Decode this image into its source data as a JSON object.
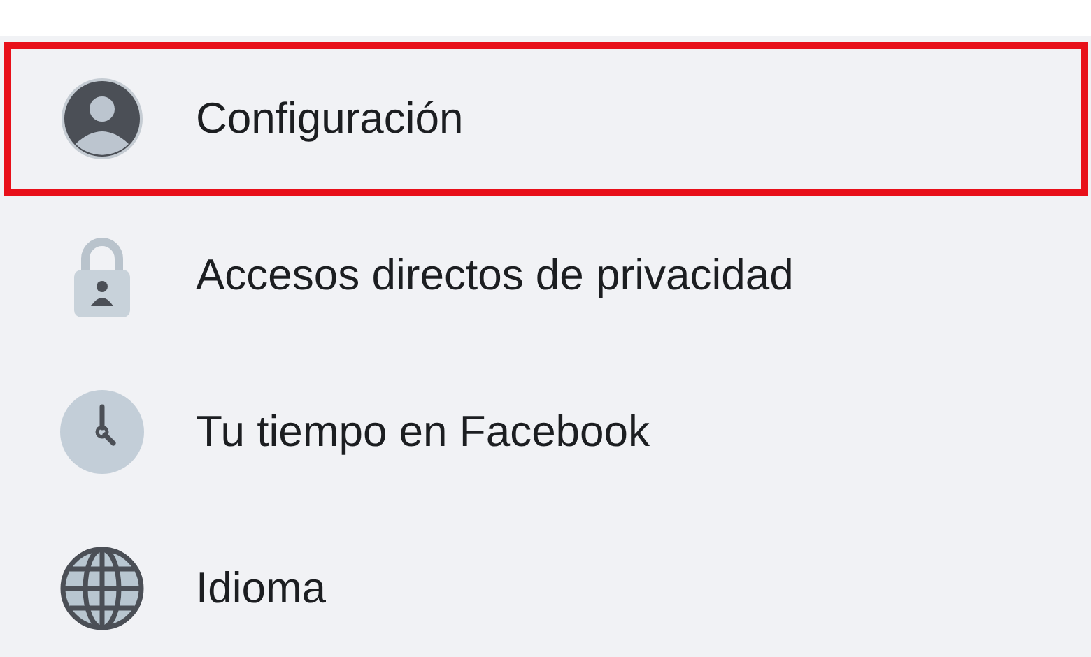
{
  "menu_items": [
    {
      "kind": "profile",
      "label": "Configuración",
      "highlighted": true
    },
    {
      "kind": "lock",
      "label": "Accesos directos de privacidad",
      "highlighted": false
    },
    {
      "kind": "clock",
      "label": "Tu tiempo en Facebook",
      "highlighted": false
    },
    {
      "kind": "globe",
      "label": "Idioma",
      "highlighted": false
    }
  ]
}
